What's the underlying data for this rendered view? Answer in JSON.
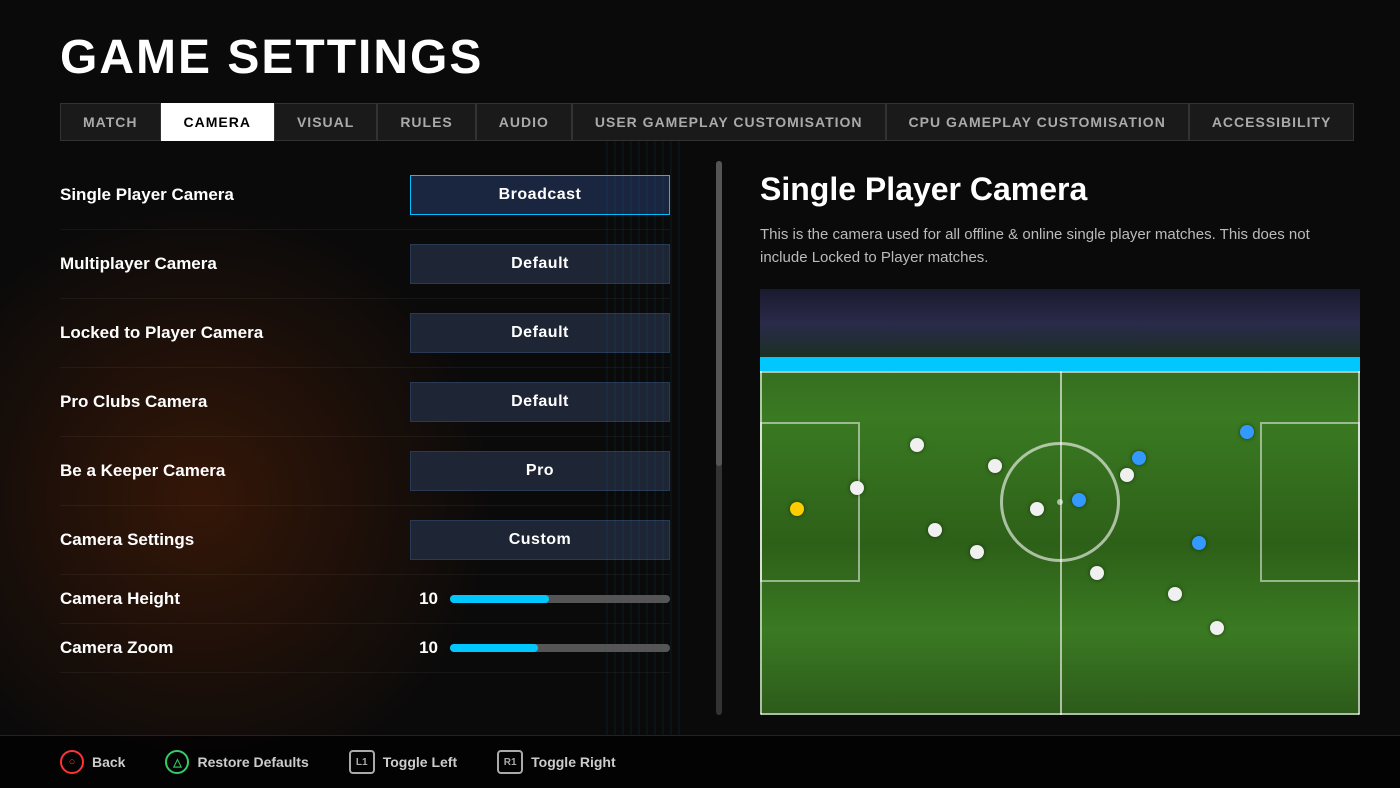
{
  "page": {
    "title": "GAME SETTINGS"
  },
  "tabs": [
    {
      "id": "match",
      "label": "MATCH",
      "active": false
    },
    {
      "id": "camera",
      "label": "CAMERA",
      "active": true
    },
    {
      "id": "visual",
      "label": "VISUAL",
      "active": false
    },
    {
      "id": "rules",
      "label": "RULES",
      "active": false
    },
    {
      "id": "audio",
      "label": "AUDIO",
      "active": false
    },
    {
      "id": "user-gameplay",
      "label": "USER GAMEPLAY CUSTOMISATION",
      "active": false
    },
    {
      "id": "cpu-gameplay",
      "label": "CPU GAMEPLAY CUSTOMISATION",
      "active": false
    },
    {
      "id": "accessibility",
      "label": "ACCESSIBILITY",
      "active": false
    }
  ],
  "settings": {
    "rows": [
      {
        "id": "single-player-camera",
        "label": "Single Player Camera",
        "type": "dropdown",
        "value": "Broadcast",
        "highlight": true
      },
      {
        "id": "multiplayer-camera",
        "label": "Multiplayer Camera",
        "type": "dropdown",
        "value": "Default",
        "highlight": false
      },
      {
        "id": "locked-player-camera",
        "label": "Locked to Player Camera",
        "type": "dropdown",
        "value": "Default",
        "highlight": false
      },
      {
        "id": "pro-clubs-camera",
        "label": "Pro Clubs Camera",
        "type": "dropdown",
        "value": "Default",
        "highlight": false
      },
      {
        "id": "be-a-keeper-camera",
        "label": "Be a Keeper Camera",
        "type": "dropdown",
        "value": "Pro",
        "highlight": false
      },
      {
        "id": "camera-settings",
        "label": "Camera Settings",
        "type": "dropdown",
        "value": "Custom",
        "highlight": false
      }
    ],
    "sliders": [
      {
        "id": "camera-height",
        "label": "Camera Height",
        "value": 10,
        "percent": 45
      },
      {
        "id": "camera-zoom",
        "label": "Camera Zoom",
        "value": 10,
        "percent": 40
      }
    ]
  },
  "info_panel": {
    "title": "Single Player Camera",
    "description": "This is the camera used for all offline & online single player matches. This does not include Locked to Player matches."
  },
  "bottom_bar": {
    "back_label": "Back",
    "restore_label": "Restore Defaults",
    "toggle_left_label": "Toggle Left",
    "toggle_right_label": "Toggle Right",
    "back_icon": "○",
    "restore_icon": "△",
    "l1_icon": "L1",
    "r1_icon": "R1"
  }
}
